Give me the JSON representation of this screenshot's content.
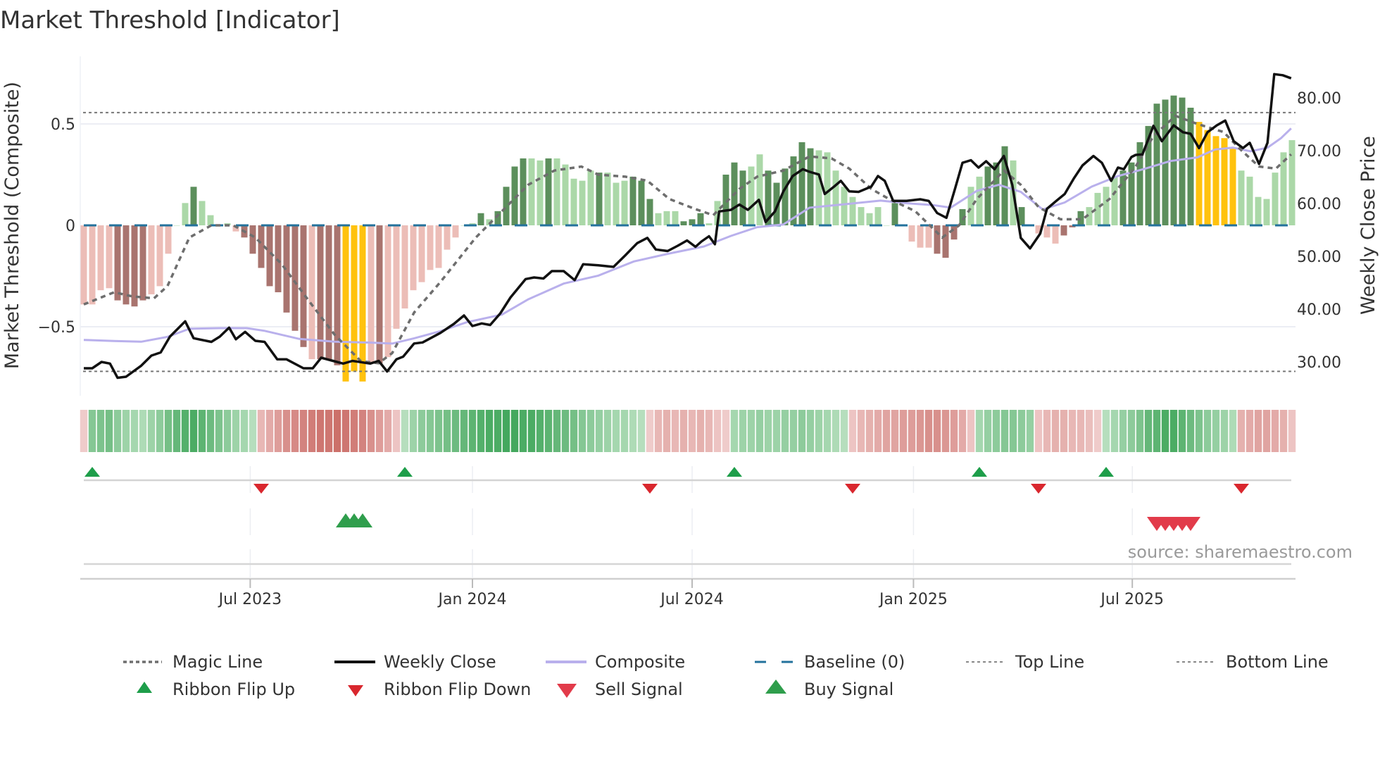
{
  "title": "Market Threshold [Indicator]",
  "source": "source: sharemaestro.com",
  "colors": {
    "bar_pos_dark": "#5c8f5c",
    "bar_pos_light": "#abd8a8",
    "bar_neg_dark": "#a9746f",
    "bar_neg_light": "#ecbdb7",
    "bar_extreme": "#ffc20e",
    "magic": "#6e6e6e",
    "close": "#111111",
    "composite": "#b9b0ec",
    "baseline": "#23729c",
    "flip_up": "#1e9e4a",
    "flip_down": "#d9272e",
    "sell": "#e23b4a",
    "buy": "#2f9e4c"
  },
  "chart_data": {
    "type": "bar+line",
    "title": "Market Threshold [Indicator]",
    "ylabel": "Market Threshold (Composite)",
    "y2label": "Weekly Close Price",
    "ylim": [
      -0.85,
      0.85
    ],
    "y2lim": [
      24,
      93
    ],
    "yticks": [
      {
        "v": 0.5,
        "label": "0.5"
      },
      {
        "v": 0,
        "label": "0"
      },
      {
        "v": -0.5,
        "label": "−0.5"
      }
    ],
    "y2ticks": [
      {
        "v": 80,
        "label": "80.00"
      },
      {
        "v": 70,
        "label": "70.00"
      },
      {
        "v": 60,
        "label": "60.00"
      },
      {
        "v": 50,
        "label": "50.00"
      },
      {
        "v": 40,
        "label": "40.00"
      },
      {
        "v": 30,
        "label": "30.00"
      }
    ],
    "xticks": [
      {
        "week": 19.7,
        "label": "Jul 2023"
      },
      {
        "week": 46.0,
        "label": "Jan 2024"
      },
      {
        "week": 72.0,
        "label": "Jul 2024"
      },
      {
        "week": 98.2,
        "label": "Jan 2025"
      },
      {
        "week": 124.1,
        "label": "Jul 2025"
      }
    ],
    "top_line": 0.556,
    "bottom_line": -0.72,
    "baseline": 0,
    "bars": {
      "values": [
        -0.39,
        -0.39,
        -0.32,
        -0.31,
        -0.37,
        -0.39,
        -0.4,
        -0.37,
        -0.34,
        -0.3,
        -0.14,
        0,
        0.11,
        0.19,
        0.12,
        0.05,
        0,
        0.01,
        -0.03,
        -0.06,
        -0.14,
        -0.21,
        -0.3,
        -0.33,
        -0.43,
        -0.52,
        -0.6,
        -0.66,
        -0.66,
        -0.66,
        -0.69,
        -0.77,
        -0.72,
        -0.77,
        -0.68,
        -0.68,
        -0.65,
        -0.51,
        -0.41,
        -0.32,
        -0.28,
        -0.22,
        -0.21,
        -0.12,
        -0.06,
        0,
        0.01,
        0.06,
        0.03,
        0.07,
        0.19,
        0.29,
        0.33,
        0.33,
        0.32,
        0.33,
        0.33,
        0.3,
        0.23,
        0.22,
        0.27,
        0.26,
        0.26,
        0.21,
        0.22,
        0.24,
        0.22,
        0.13,
        0.06,
        0.07,
        0.07,
        0.02,
        0.03,
        0.06,
        0.01,
        0.12,
        0.25,
        0.31,
        0.27,
        0.29,
        0.35,
        0.27,
        0.21,
        0.28,
        0.34,
        0.41,
        0.38,
        0.37,
        0.36,
        0.27,
        0.19,
        0.14,
        0.09,
        0.06,
        0.09,
        0,
        0.11,
        0,
        -0.08,
        -0.11,
        -0.11,
        -0.14,
        -0.16,
        -0.07,
        0.08,
        0.19,
        0.24,
        0.29,
        0.31,
        0.39,
        0.32,
        0.09,
        0,
        -0.04,
        -0.06,
        -0.09,
        -0.05,
        -0.01,
        0.07,
        0.09,
        0.16,
        0.19,
        0.24,
        0.27,
        0.31,
        0.41,
        0.49,
        0.6,
        0.62,
        0.64,
        0.63,
        0.58,
        0.51,
        0.47,
        0.44,
        0.43,
        0.38,
        0.27,
        0.24,
        0.14,
        0.13,
        0.26,
        0.36,
        0.42
      ],
      "shades": "llllddddllllldlllllddddddddldddyyyldllllllllllldlddddlldllllldllldddllldddlldddllddddddllllllllldllllddddlldddldlllldddlllldddddddddyyyyylllllllllddd"
    },
    "magic_line": [
      [
        0,
        -0.39
      ],
      [
        3.6,
        -0.33
      ],
      [
        5.7,
        -0.35
      ],
      [
        8.3,
        -0.36
      ],
      [
        9.9,
        -0.3
      ],
      [
        12.5,
        -0.06
      ],
      [
        15.1,
        0
      ],
      [
        17.7,
        0
      ],
      [
        20.3,
        -0.06
      ],
      [
        23.4,
        -0.19
      ],
      [
        26.6,
        -0.37
      ],
      [
        29.7,
        -0.54
      ],
      [
        32.8,
        -0.67
      ],
      [
        34.9,
        -0.68
      ],
      [
        36.5,
        -0.63
      ],
      [
        39.1,
        -0.43
      ],
      [
        42.2,
        -0.28
      ],
      [
        46.4,
        -0.06
      ],
      [
        49.5,
        0.07
      ],
      [
        52.6,
        0.2
      ],
      [
        55.7,
        0.27
      ],
      [
        58.9,
        0.29
      ],
      [
        60.9,
        0.25
      ],
      [
        64.1,
        0.24
      ],
      [
        66.7,
        0.22
      ],
      [
        69.3,
        0.13
      ],
      [
        72.4,
        0.08
      ],
      [
        74.5,
        0.05
      ],
      [
        77.6,
        0.18
      ],
      [
        79.7,
        0.24
      ],
      [
        82.8,
        0.27
      ],
      [
        85.9,
        0.34
      ],
      [
        88.5,
        0.33
      ],
      [
        90.6,
        0.28
      ],
      [
        93.2,
        0.18
      ],
      [
        95.3,
        0.13
      ],
      [
        98.4,
        0.07
      ],
      [
        101.6,
        -0.06
      ],
      [
        103.6,
        0
      ],
      [
        105.7,
        0.13
      ],
      [
        108.9,
        0.27
      ],
      [
        110.9,
        0.2
      ],
      [
        113,
        0.09
      ],
      [
        115.6,
        0.03
      ],
      [
        118.2,
        0.03
      ],
      [
        121.4,
        0.13
      ],
      [
        124.5,
        0.29
      ],
      [
        126.6,
        0.44
      ],
      [
        129.2,
        0.54
      ],
      [
        131.8,
        0.5
      ],
      [
        134.9,
        0.46
      ],
      [
        137,
        0.37
      ],
      [
        139.1,
        0.29
      ],
      [
        141.1,
        0.28
      ],
      [
        142.9,
        0.35
      ]
    ],
    "composite": [
      [
        0,
        -0.565
      ],
      [
        3.6,
        -0.57
      ],
      [
        6.8,
        -0.574
      ],
      [
        9.9,
        -0.55
      ],
      [
        12.5,
        -0.51
      ],
      [
        16.1,
        -0.507
      ],
      [
        19.3,
        -0.507
      ],
      [
        21.4,
        -0.52
      ],
      [
        25.5,
        -0.56
      ],
      [
        29.7,
        -0.574
      ],
      [
        33.9,
        -0.578
      ],
      [
        36.5,
        -0.583
      ],
      [
        39.1,
        -0.557
      ],
      [
        42.2,
        -0.522
      ],
      [
        45.3,
        -0.478
      ],
      [
        49.5,
        -0.44
      ],
      [
        52.6,
        -0.365
      ],
      [
        56.8,
        -0.287
      ],
      [
        60.9,
        -0.248
      ],
      [
        65.1,
        -0.178
      ],
      [
        69.3,
        -0.139
      ],
      [
        73.4,
        -0.104
      ],
      [
        76.6,
        -0.052
      ],
      [
        79.7,
        -0.009
      ],
      [
        82.8,
        0.004
      ],
      [
        85.9,
        0.087
      ],
      [
        90.1,
        0.104
      ],
      [
        94.3,
        0.122
      ],
      [
        97.4,
        0.109
      ],
      [
        100.5,
        0.1
      ],
      [
        102.6,
        0.087
      ],
      [
        105.7,
        0.17
      ],
      [
        108.3,
        0.2
      ],
      [
        110.9,
        0.165
      ],
      [
        113.5,
        0.078
      ],
      [
        116.1,
        0.113
      ],
      [
        119.3,
        0.191
      ],
      [
        122.4,
        0.243
      ],
      [
        125.5,
        0.278
      ],
      [
        128.6,
        0.317
      ],
      [
        131.8,
        0.335
      ],
      [
        133.9,
        0.374
      ],
      [
        136,
        0.383
      ],
      [
        138.1,
        0.365
      ],
      [
        140.1,
        0.383
      ],
      [
        141.7,
        0.43
      ],
      [
        142.9,
        0.478
      ]
    ],
    "weekly_close": [
      [
        0,
        28.8
      ],
      [
        1,
        28.8
      ],
      [
        2.1,
        30
      ],
      [
        3.1,
        29.7
      ],
      [
        4,
        27
      ],
      [
        5,
        27.2
      ],
      [
        6.8,
        29.3
      ],
      [
        8,
        31.2
      ],
      [
        9.1,
        31.8
      ],
      [
        10.2,
        34.8
      ],
      [
        12,
        37.7
      ],
      [
        13,
        34.5
      ],
      [
        15.1,
        33.8
      ],
      [
        16.1,
        34.8
      ],
      [
        17.2,
        36.5
      ],
      [
        18,
        34.3
      ],
      [
        19.1,
        35.7
      ],
      [
        20.3,
        34
      ],
      [
        21.4,
        33.8
      ],
      [
        22.9,
        30.5
      ],
      [
        24,
        30.5
      ],
      [
        26,
        28.8
      ],
      [
        27.1,
        28.8
      ],
      [
        28.1,
        30.8
      ],
      [
        29.5,
        30.2
      ],
      [
        30.7,
        29.7
      ],
      [
        31.8,
        30.2
      ],
      [
        33.9,
        29.7
      ],
      [
        34.9,
        30.2
      ],
      [
        35.9,
        28.2
      ],
      [
        37,
        30.5
      ],
      [
        37.8,
        31
      ],
      [
        39.1,
        33.5
      ],
      [
        40.1,
        33.7
      ],
      [
        42.2,
        35.5
      ],
      [
        43.8,
        37.2
      ],
      [
        45,
        38.8
      ],
      [
        46,
        36.8
      ],
      [
        47.1,
        37.3
      ],
      [
        48.1,
        37
      ],
      [
        49.3,
        39.2
      ],
      [
        50.5,
        42.2
      ],
      [
        52.3,
        45.7
      ],
      [
        53.3,
        46
      ],
      [
        54.4,
        45.8
      ],
      [
        55.4,
        47.2
      ],
      [
        56.8,
        47.2
      ],
      [
        58.1,
        45.5
      ],
      [
        59.1,
        48.5
      ],
      [
        60.9,
        48.3
      ],
      [
        62.7,
        48
      ],
      [
        64.1,
        50.2
      ],
      [
        65.5,
        52.5
      ],
      [
        66.7,
        53.5
      ],
      [
        67.7,
        51.3
      ],
      [
        69.1,
        51
      ],
      [
        70.3,
        52
      ],
      [
        71.4,
        53
      ],
      [
        72.4,
        51.8
      ],
      [
        73.1,
        52.8
      ],
      [
        74,
        53.8
      ],
      [
        74.7,
        52.3
      ],
      [
        75.2,
        58.5
      ],
      [
        76.6,
        58.8
      ],
      [
        77.6,
        59.8
      ],
      [
        78.6,
        58.8
      ],
      [
        79.9,
        60.7
      ],
      [
        80.7,
        56.5
      ],
      [
        81.8,
        58.5
      ],
      [
        82.8,
        62.3
      ],
      [
        83.9,
        65.2
      ],
      [
        85.1,
        66.5
      ],
      [
        85.9,
        66
      ],
      [
        87,
        65.5
      ],
      [
        87.7,
        61.8
      ],
      [
        88.8,
        63.2
      ],
      [
        89.6,
        64.3
      ],
      [
        90.6,
        62.3
      ],
      [
        91.7,
        62.2
      ],
      [
        93.2,
        63.2
      ],
      [
        94,
        65.2
      ],
      [
        94.8,
        64.3
      ],
      [
        95.8,
        60.5
      ],
      [
        97.4,
        60.5
      ],
      [
        99,
        60.8
      ],
      [
        100,
        60.5
      ],
      [
        101,
        58.2
      ],
      [
        102.1,
        57.3
      ],
      [
        103.1,
        62.7
      ],
      [
        104,
        67.7
      ],
      [
        105,
        68.2
      ],
      [
        105.9,
        66.8
      ],
      [
        106.8,
        68
      ],
      [
        107.8,
        66.5
      ],
      [
        108.9,
        69
      ],
      [
        109.9,
        63.5
      ],
      [
        110.9,
        53.5
      ],
      [
        112,
        51.5
      ],
      [
        113.2,
        54.3
      ],
      [
        114,
        59
      ],
      [
        115.1,
        60.5
      ],
      [
        116.1,
        61.8
      ],
      [
        117.2,
        64.8
      ],
      [
        118.2,
        67.2
      ],
      [
        119.5,
        69
      ],
      [
        120.5,
        67.7
      ],
      [
        121.6,
        64.3
      ],
      [
        122.4,
        66.8
      ],
      [
        123.1,
        66.5
      ],
      [
        124,
        68.8
      ],
      [
        124.5,
        69.2
      ],
      [
        125.3,
        69.3
      ],
      [
        126.6,
        74.7
      ],
      [
        127.6,
        71.8
      ],
      [
        129,
        74.8
      ],
      [
        130.1,
        73.5
      ],
      [
        131,
        73.2
      ],
      [
        132,
        70.5
      ],
      [
        133,
        73.5
      ],
      [
        134.1,
        74.8
      ],
      [
        135.1,
        75.7
      ],
      [
        136.1,
        71.8
      ],
      [
        137.2,
        70.5
      ],
      [
        138,
        71.5
      ],
      [
        139.1,
        67.5
      ],
      [
        140.1,
        71.5
      ],
      [
        140.9,
        84.5
      ],
      [
        141.9,
        84.3
      ],
      [
        142.9,
        83.7
      ]
    ],
    "ribbon": [
      -0.15,
      0.5,
      0.55,
      0.6,
      0.45,
      0.35,
      0.3,
      0.25,
      0.35,
      0.45,
      0.6,
      0.7,
      0.8,
      0.85,
      0.75,
      0.65,
      0.55,
      0.45,
      0.35,
      0.3,
      0.2,
      -0.3,
      -0.4,
      -0.5,
      -0.6,
      -0.65,
      -0.7,
      -0.75,
      -0.8,
      -0.8,
      -0.85,
      -0.8,
      -0.75,
      -0.7,
      -0.6,
      -0.5,
      -0.4,
      -0.2,
      0.2,
      0.35,
      0.45,
      0.5,
      0.55,
      0.6,
      0.65,
      0.7,
      0.75,
      0.8,
      0.85,
      0.85,
      0.9,
      0.9,
      0.85,
      0.85,
      0.8,
      0.75,
      0.7,
      0.65,
      0.6,
      0.5,
      0.45,
      0.4,
      0.35,
      0.3,
      0.3,
      0.25,
      0.2,
      -0.15,
      -0.3,
      -0.35,
      -0.3,
      -0.35,
      -0.3,
      -0.35,
      -0.3,
      -0.2,
      -0.15,
      0.3,
      0.35,
      0.35,
      0.4,
      0.35,
      0.35,
      0.4,
      0.4,
      0.45,
      0.4,
      0.35,
      0.3,
      0.25,
      0.2,
      -0.2,
      -0.3,
      -0.35,
      -0.4,
      -0.45,
      -0.45,
      -0.5,
      -0.5,
      -0.55,
      -0.6,
      -0.6,
      -0.55,
      -0.5,
      -0.4,
      -0.2,
      0.3,
      0.4,
      0.45,
      0.5,
      0.5,
      0.45,
      0.4,
      -0.2,
      -0.3,
      -0.35,
      -0.35,
      -0.3,
      -0.3,
      -0.25,
      -0.15,
      0.2,
      0.3,
      0.4,
      0.45,
      0.55,
      0.7,
      0.75,
      0.85,
      0.85,
      0.75,
      0.65,
      0.55,
      0.45,
      0.4,
      0.35,
      0.25,
      -0.35,
      -0.4,
      -0.45,
      -0.45,
      -0.4,
      -0.35,
      -0.2
    ],
    "ribbon_flip_up": [
      1,
      38,
      77,
      106,
      121
    ],
    "ribbon_flip_down": [
      21,
      67,
      91,
      113,
      137
    ],
    "buy_signals": [
      31,
      32,
      33
    ],
    "sell_signals": [
      127,
      128,
      129,
      130,
      131
    ],
    "legend": {
      "placement": "bottom",
      "items": [
        {
          "key": "magic",
          "label": "Magic Line"
        },
        {
          "key": "close",
          "label": "Weekly Close"
        },
        {
          "key": "composite",
          "label": "Composite"
        },
        {
          "key": "baseline",
          "label": "Baseline (0)"
        },
        {
          "key": "top",
          "label": "Top Line"
        },
        {
          "key": "bottom",
          "label": "Bottom Line"
        },
        {
          "key": "flip_up",
          "label": "Ribbon Flip Up"
        },
        {
          "key": "flip_down",
          "label": "Ribbon Flip Down"
        },
        {
          "key": "sell",
          "label": "Sell Signal"
        },
        {
          "key": "buy",
          "label": "Buy Signal"
        }
      ]
    }
  }
}
